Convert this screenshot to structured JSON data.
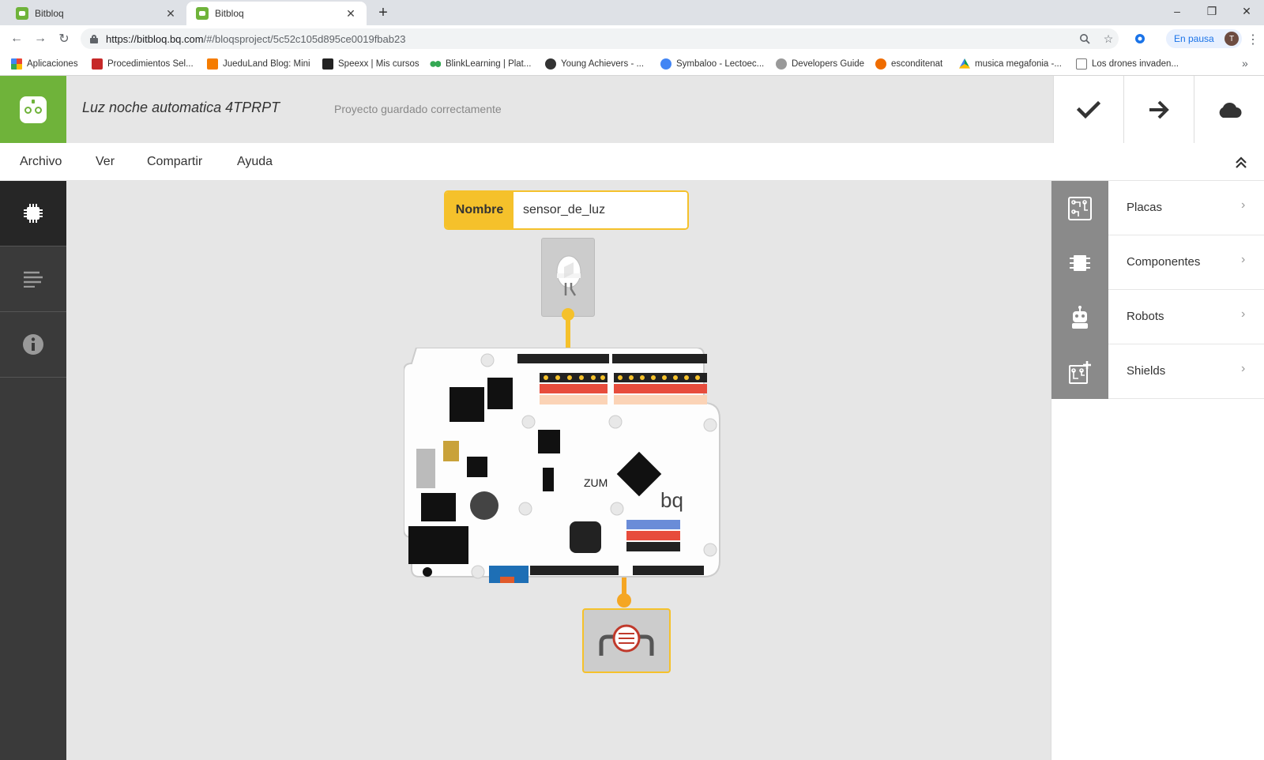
{
  "browser": {
    "tabs": [
      {
        "title": "Bitbloq",
        "active": false
      },
      {
        "title": "Bitbloq",
        "active": true
      }
    ],
    "new_tab": "+",
    "window_controls": {
      "minimize": "–",
      "restore": "❐",
      "close": "✕"
    },
    "nav": {
      "back": "←",
      "forward": "→",
      "reload": "↻"
    },
    "url_host": "https://bitbloq.bq.com",
    "url_rest": "/#/bloqsproject/5c52c105d895ce0019fbab23",
    "zoom_icon": "zoom-icon",
    "star_icon": "star-icon",
    "pause_label": "En pausa",
    "avatar_initial": "T",
    "bookmarks": [
      {
        "label": "Aplicaciones",
        "color": "#e94235"
      },
      {
        "label": "Procedimientos Sel...",
        "color": "#c62828"
      },
      {
        "label": "JueduLand Blog: Mini",
        "color": "#f57c00"
      },
      {
        "label": "Speexx | Mis cursos",
        "color": "#222222"
      },
      {
        "label": "BlinkLearning | Plat...",
        "color": "#34a853"
      },
      {
        "label": "Young Achievers - ...",
        "color": "#333333"
      },
      {
        "label": "Symbaloo - Lectoec...",
        "color": "#4285f4"
      },
      {
        "label": "Developers Guide",
        "color": "#888888"
      },
      {
        "label": "esconditenat",
        "color": "#ef6c00"
      },
      {
        "label": "musica megafonia -...",
        "color": "#0f9d58"
      },
      {
        "label": "Los drones invaden...",
        "color": "#777777"
      }
    ],
    "bookmarks_more": "»"
  },
  "app": {
    "project_title": "Luz noche automatica 4TPRPT",
    "save_status": "Proyecto guardado correctamente",
    "accent": "#6fb33a",
    "highlight": "#f5c12b",
    "header_actions": [
      "verify-icon",
      "upload-arrow-icon",
      "cloud-icon"
    ],
    "menu": [
      "Archivo",
      "Ver",
      "Compartir",
      "Ayuda"
    ],
    "left_tabs": [
      "hardware-chip-icon",
      "code-lines-icon",
      "info-icon"
    ],
    "nombre_label": "Nombre",
    "nombre_value": "sensor_de_luz",
    "board_label": "ZUM",
    "board_brand": "bq",
    "right_sidebar": [
      {
        "label": "Placas",
        "icon": "board-icon"
      },
      {
        "label": "Componentes",
        "icon": "chip-icon"
      },
      {
        "label": "Robots",
        "icon": "robot-icon"
      },
      {
        "label": "Shields",
        "icon": "shield-icon"
      }
    ]
  }
}
